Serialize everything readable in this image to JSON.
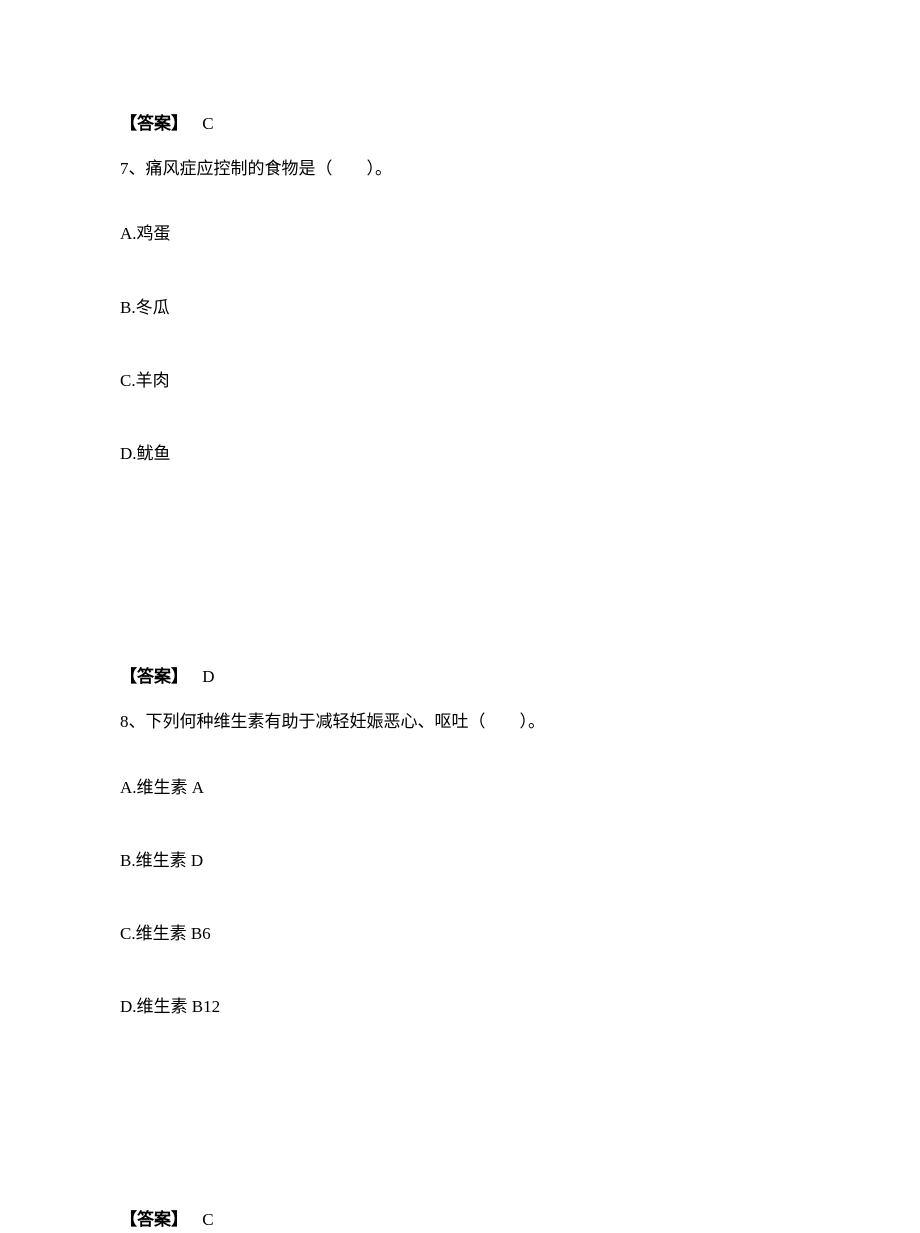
{
  "answer_prev": {
    "label": "【答案】",
    "value": "C"
  },
  "q7": {
    "number": "7、",
    "text": "痛风症应控制的食物是（　　）。",
    "options": {
      "a": "A.鸡蛋",
      "b": "B.冬瓜",
      "c": "C.羊肉",
      "d": "D.鱿鱼"
    },
    "answer": {
      "label": "【答案】",
      "value": "D"
    }
  },
  "q8": {
    "number": "8、",
    "text": "下列何种维生素有助于减轻妊娠恶心、呕吐（　　）。",
    "options": {
      "a": "A.维生素 A",
      "b": "B.维生素 D",
      "c": "C.维生素 B6",
      "d": "D.维生素 B12"
    },
    "answer": {
      "label": "【答案】",
      "value": "C"
    }
  }
}
